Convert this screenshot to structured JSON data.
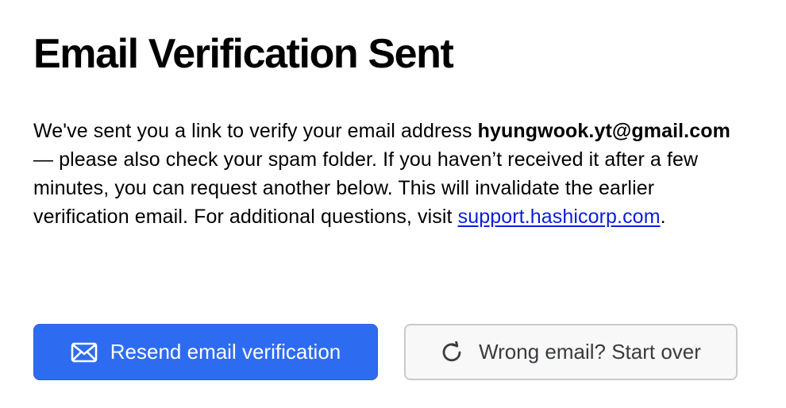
{
  "heading": "Email Verification Sent",
  "message": {
    "intro": "We've sent you a link to verify your email address ",
    "email": "hyungwook.yt@gmail.com",
    "middle": " — please also check your spam folder. If you haven’t received it after a few minutes, you can request another below. This will invalidate the earlier verification email. For additional questions, visit ",
    "support_link": "support.hashicorp.com",
    "end": "."
  },
  "buttons": {
    "resend": {
      "label": "Resend email verification",
      "icon": "mail-icon",
      "color": "#2d6cf0"
    },
    "start_over": {
      "label": "Wrong email? Start over",
      "icon": "refresh-icon"
    }
  }
}
